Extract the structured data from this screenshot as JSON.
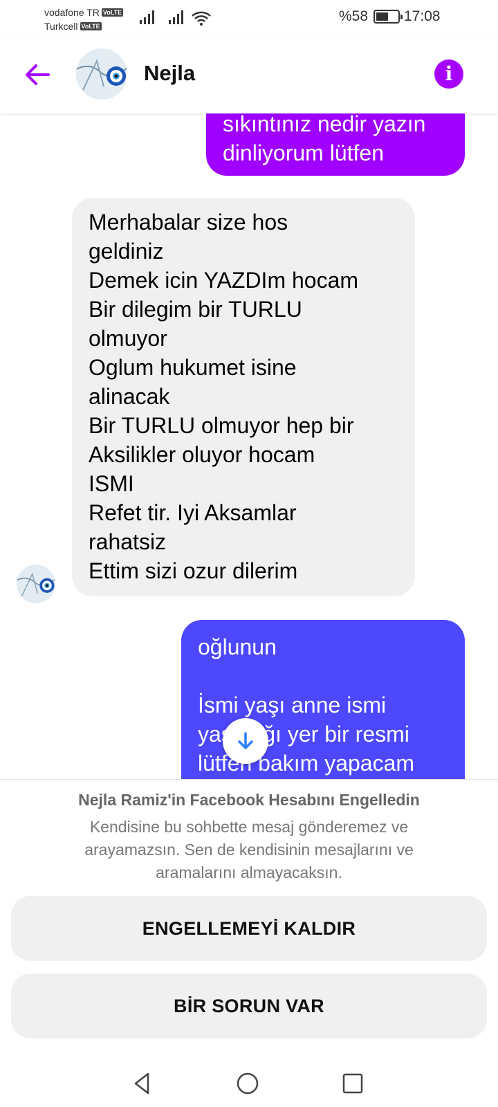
{
  "status_bar": {
    "carrier_1": "vodafone TR",
    "carrier_2": "Turkcell",
    "volte_badge": "VoLTE",
    "battery_text": "%58",
    "battery_level": 0.58,
    "time": "17:08"
  },
  "header": {
    "contact_name": "Nejla",
    "back_icon": "arrow-left-icon",
    "info_icon": "info-icon",
    "info_glyph": "i",
    "accent_color": "#a600ff"
  },
  "messages": [
    {
      "direction": "outgoing",
      "text": "sıkıntınız nedir yazın\ndinliyorum lütfen",
      "color": "#9f00ff"
    },
    {
      "direction": "incoming",
      "text": "Merhabalar size hos\ngeldiniz\nDemek icin YAZDIm hocam\nBir dilegim bir TURLU\nolmuyor\nOglum  hukumet  isine\nalinacak\nBir TURLU  olmuyor hep bir\nAksilikler   oluyor hocam\nISMI\nRefet tir. Iyi Aksamlar\nrahatsiz\nEttim sizi ozur dilerim",
      "color": "#f0f0f0"
    },
    {
      "direction": "outgoing",
      "text": "oğlunun\n\nİsmi yaşı anne ismi\nyaşadığı yer bir resmi\nlütfen bakım yapacam",
      "color": "#4d48fe"
    }
  ],
  "scroll_down_icon": "arrow-down-icon",
  "blocked_panel": {
    "title": "Nejla Ramiz'in Facebook Hesabını Engelledin",
    "description": "Kendisine bu sohbette mesaj gönderemez ve arayamazsın. Sen de kendisinin mesajlarını ve aramalarını almayacaksın.",
    "unblock_label": "ENGELLEMEYİ KALDIR",
    "report_label": "BİR SORUN VAR"
  },
  "nav_bar": {
    "back_icon": "triangle-back-icon",
    "home_icon": "circle-home-icon",
    "recents_icon": "square-recents-icon"
  }
}
